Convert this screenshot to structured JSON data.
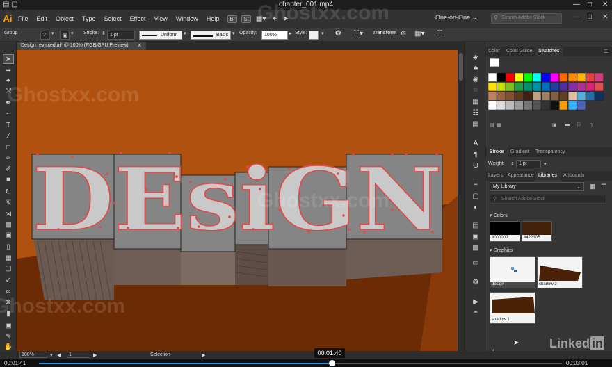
{
  "player": {
    "title": "chapter_001.mp4"
  },
  "menubar": {
    "logo": "Ai",
    "items": [
      "File",
      "Edit",
      "Object",
      "Type",
      "Select",
      "Effect",
      "View",
      "Window",
      "Help"
    ],
    "badges": [
      "Br",
      "St"
    ],
    "workspace": "One-on-One",
    "search_placeholder": "Search Adobe Stock"
  },
  "controlbar": {
    "selection": "Group",
    "stroke_label": "Stroke:",
    "stroke_value": "1 pt",
    "profile": "Uniform",
    "brush": "Basic",
    "opacity_label": "Opacity:",
    "opacity_value": "100%",
    "style_label": "Style:",
    "transform": "Transform"
  },
  "document": {
    "tab_title": "Design revisited.ai* @ 100% (RGB/GPU Preview)"
  },
  "artwork": {
    "text": "DEsiGN"
  },
  "panels": {
    "top_tabs": [
      "Color",
      "Color Guide",
      "Swatches"
    ],
    "mid_tabs": [
      "Stroke",
      "Gradient",
      "Transparency"
    ],
    "weight_label": "Weight:",
    "weight_value": "1 pt",
    "lower_tabs": [
      "Layers",
      "Appearance",
      "Libraries",
      "Artboards"
    ],
    "library_name": "My Library",
    "library_search": "Search Adobe Stock",
    "colors_header": "Colors",
    "colors": [
      {
        "label": "#000000",
        "hex": "#000000"
      },
      {
        "label": "#42210B",
        "hex": "#42210B"
      }
    ],
    "graphics_header": "Graphics",
    "graphics": [
      "design",
      "shadow 2",
      "shadow 1"
    ]
  },
  "statusbar": {
    "zoom": "100%",
    "artboard": "1",
    "tool": "Selection"
  },
  "video": {
    "elapsed": "00:01:41",
    "hover_time": "00:01:40",
    "total": "00:03:01",
    "progress": 0.56
  },
  "watermark": "Ghostxx.com",
  "brand": {
    "linkedin_a": "Linked",
    "linkedin_b": "in"
  }
}
